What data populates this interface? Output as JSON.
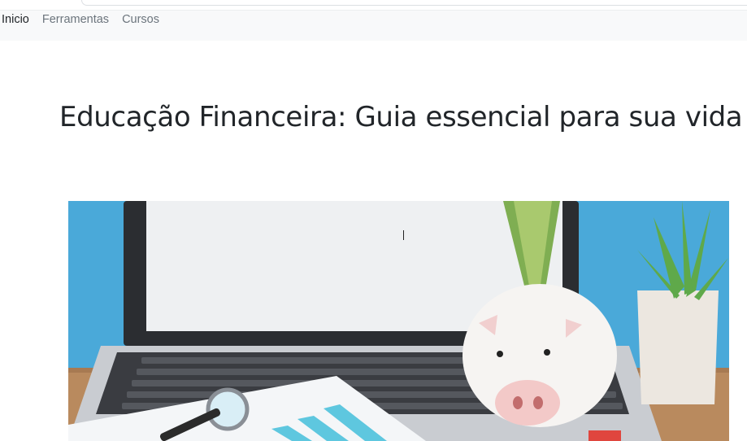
{
  "nav": {
    "items": [
      {
        "label": "Inicio",
        "active": true
      },
      {
        "label": "Ferramentas",
        "active": false
      },
      {
        "label": "Cursos",
        "active": false
      }
    ]
  },
  "article": {
    "title": "Educação Financeira: Guia essencial para sua vida"
  },
  "hero_image": {
    "subject": "laptop, piggy bank with banknote, magnifying glass, bar chart papers, potted succulent"
  },
  "colors": {
    "navbar_bg": "#f8f9fa",
    "text_dark": "#212529",
    "nav_muted": "#6c757d",
    "wall_blue": "#4aa9d9"
  }
}
